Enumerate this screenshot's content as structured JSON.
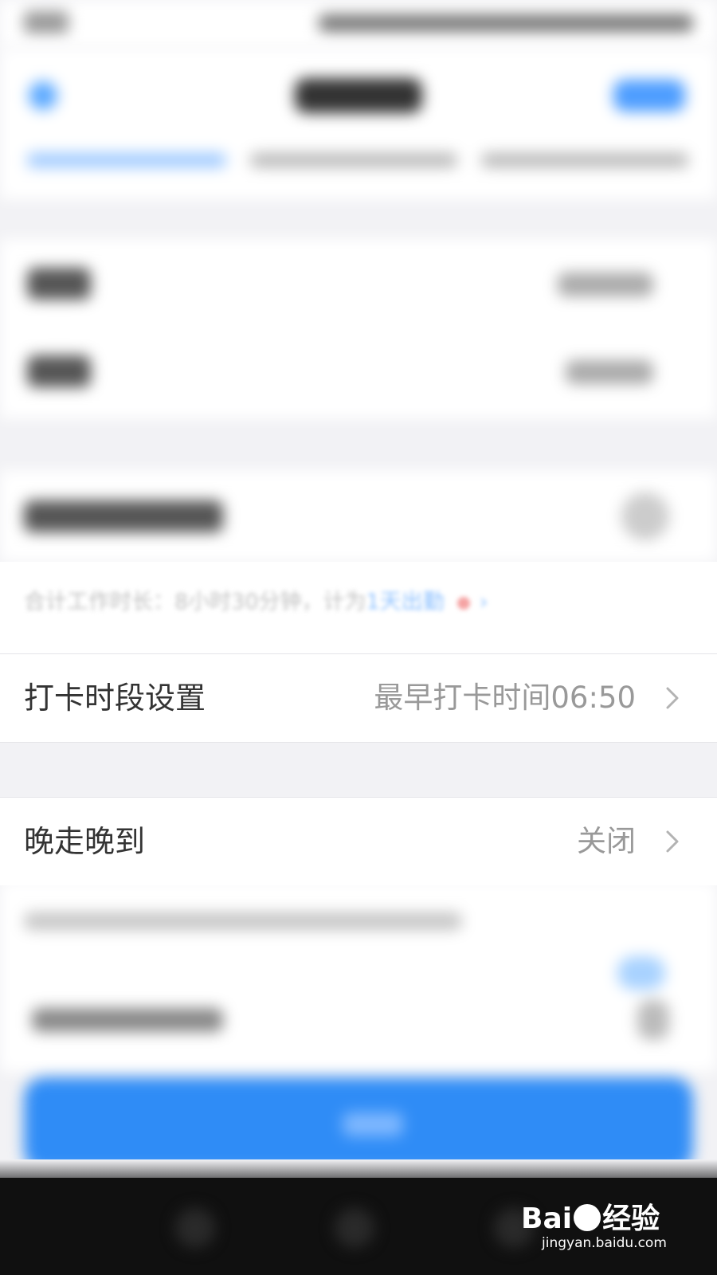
{
  "summary": {
    "duration_prefix": "合计工作时长：8小时30分钟，计为",
    "duration_link": "1天出勤"
  },
  "settings": [
    {
      "label": "打卡时段设置",
      "value": "最早打卡时间06:50"
    },
    {
      "label": "晚走晚到",
      "value": "关闭"
    }
  ],
  "icons": {
    "back": "back-arrow-icon",
    "chevron": "chevron-right-icon",
    "notification": "red-dot-icon"
  },
  "colors": {
    "primary": "#2f8cf6",
    "link": "#8cc0ff",
    "text_secondary": "#999999",
    "background": "#f2f2f5"
  },
  "watermark": {
    "logo": "Baidu经验",
    "url": "jingyan.baidu.com"
  }
}
